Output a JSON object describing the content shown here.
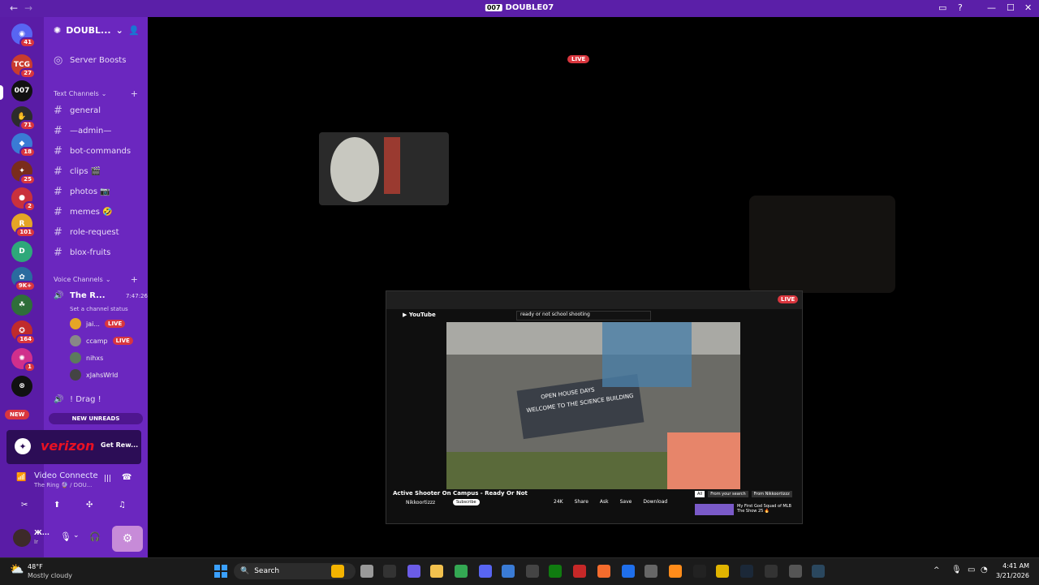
{
  "titlebar": {
    "back": "←",
    "forward": "→",
    "app_logo": "007",
    "title": "DOUBLE07",
    "inbox_icon": "inbox-icon",
    "help_icon": "help-icon",
    "minimize": "—",
    "maximize": "☐",
    "close": "✕"
  },
  "servers": [
    {
      "id": "home",
      "glyph": "◉",
      "color": "#5865f2",
      "badge": "41"
    },
    {
      "id": "tcg",
      "glyph": "TCG",
      "color": "#c93c2f",
      "badge": "27"
    },
    {
      "id": "double07",
      "glyph": "007",
      "color": "#111111",
      "badge": ""
    },
    {
      "id": "s4",
      "glyph": "✋",
      "color": "#2c2c2c",
      "badge": "71"
    },
    {
      "id": "s5",
      "glyph": "◆",
      "color": "#3a7bd5",
      "badge": "18"
    },
    {
      "id": "s6",
      "glyph": "✦",
      "color": "#7a2c1c",
      "badge": "25"
    },
    {
      "id": "s7",
      "glyph": "●",
      "color": "#c9313c",
      "badge": "2"
    },
    {
      "id": "s8",
      "glyph": "R",
      "color": "#e5a526",
      "badge": "101"
    },
    {
      "id": "s9",
      "glyph": "D",
      "color": "#2ea87a",
      "badge": ""
    },
    {
      "id": "s10",
      "glyph": "✿",
      "color": "#2a6b9f",
      "badge": "9K+"
    },
    {
      "id": "s11",
      "glyph": "☘",
      "color": "#2f6e3a",
      "badge": ""
    },
    {
      "id": "s12",
      "glyph": "✪",
      "color": "#c12b2b",
      "badge": "164"
    },
    {
      "id": "s13",
      "glyph": "✺",
      "color": "#d02f8c",
      "badge": "1"
    },
    {
      "id": "s14",
      "glyph": "⊗",
      "color": "#111111",
      "badge": ""
    }
  ],
  "new_pill": "NEW",
  "server_name": "DOUBL...",
  "server_boosts": "Server Boosts",
  "text_category": "Text Channels",
  "text_channels": [
    {
      "name": "general"
    },
    {
      "name": "—admin—"
    },
    {
      "name": "bot-commands"
    },
    {
      "name": "clips 🎬"
    },
    {
      "name": "photos 📷"
    },
    {
      "name": "memes 🤣"
    },
    {
      "name": "role-request"
    },
    {
      "name": "blox-fruits"
    }
  ],
  "voice_category": "Voice Channels",
  "voice_channel": {
    "name": "The R...",
    "timer": "7:47:26",
    "status": "Set a channel status"
  },
  "voice_users": [
    {
      "name": "jai...",
      "live": "LIVE",
      "color": "#e5a526"
    },
    {
      "name": "ccamp",
      "live": "LIVE",
      "color": "#888888"
    },
    {
      "name": "nihxs",
      "live": "",
      "color": "#5c7a5c"
    },
    {
      "name": "xJahsWrld",
      "live": "",
      "color": "#444444"
    }
  ],
  "voice_channel_2": "! Drag !",
  "new_unreads": "NEW UNREADS",
  "promo": {
    "brand": "verizon",
    "cta": "Get Rew..."
  },
  "voice_status": {
    "title": "Video Connecte",
    "sub": "The Ring 🔮 / DOU..."
  },
  "user_panel": {
    "name": "Ж...",
    "status": "Ir"
  },
  "stream": {
    "live_badge": "LIVE",
    "inner_live": "LIVE",
    "video_title": "Active Shooter On Campus - Ready Or Not",
    "channel": "Nikkoortizzz",
    "subs": "Subscribe",
    "search_query": "ready or not school shooting",
    "likes": "24K",
    "share": "Share",
    "ask": "Ask",
    "save": "Save",
    "download": "Download",
    "open_house": "OPEN HOUSE DAYS",
    "welcome": "WELCOME TO THE SCIENCE BUILDING",
    "sidebar_chip_all": "All",
    "sidebar_chip_search": "From your search",
    "sidebar_chip_channel": "From Nikkoortizzz",
    "rec_title": "My First God Squad of MLB The Show 25 🔥"
  },
  "taskbar": {
    "weather_temp": "48°F",
    "weather_desc": "Mostly cloudy",
    "search": "Search",
    "time": "4:41 AM",
    "date": "3/21/2026"
  }
}
